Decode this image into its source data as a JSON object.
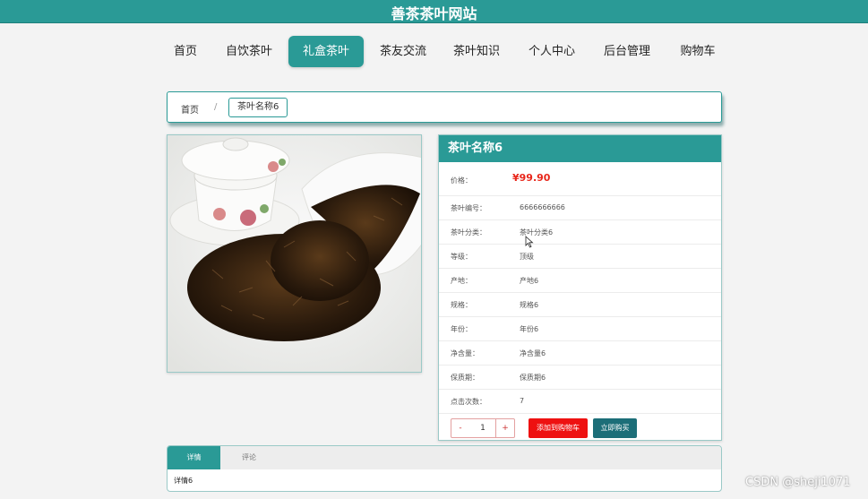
{
  "site": {
    "title": "善茶茶叶网站"
  },
  "nav": [
    {
      "label": "首页"
    },
    {
      "label": "自饮茶叶"
    },
    {
      "label": "礼盒茶叶"
    },
    {
      "label": "茶友交流"
    },
    {
      "label": "茶叶知识"
    },
    {
      "label": "个人中心"
    },
    {
      "label": "后台管理"
    },
    {
      "label": "购物车"
    }
  ],
  "breadcrumb": {
    "home": "首页",
    "separator": "/",
    "current": "茶叶名称6"
  },
  "product": {
    "name": "茶叶名称6",
    "price_label": "价格：",
    "price": "¥99.90",
    "attributes": [
      {
        "label": "茶叶编号：",
        "value": "6666666666"
      },
      {
        "label": "茶叶分类：",
        "value": "茶叶分类6"
      },
      {
        "label": "等级：",
        "value": "顶级"
      },
      {
        "label": "产地：",
        "value": "产地6"
      },
      {
        "label": "规格：",
        "value": "规格6"
      },
      {
        "label": "年份：",
        "value": "年份6"
      },
      {
        "label": "净含量：",
        "value": "净含量6"
      },
      {
        "label": "保质期：",
        "value": "保质期6"
      },
      {
        "label": "点击次数：",
        "value": "7"
      }
    ],
    "quantity": {
      "minus": "-",
      "value": "1",
      "plus": "+"
    },
    "add_to_cart": "添加到购物车",
    "buy_now": "立即购买"
  },
  "tabs": [
    {
      "label": "详情"
    },
    {
      "label": "评论"
    }
  ],
  "detail_text": "详情6",
  "watermark": "CSDN @sheji1071",
  "colors": {
    "primary": "#2a9a96",
    "price": "#e8261a",
    "cart_button": "#ee1111",
    "buy_button": "#1c6e78"
  }
}
